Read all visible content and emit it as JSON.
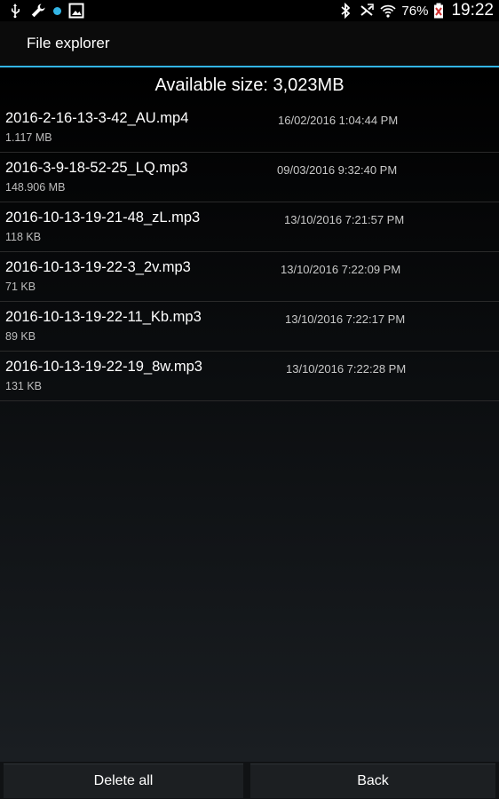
{
  "status_bar": {
    "battery_percent": "76%",
    "time": "19:22",
    "left_icons": [
      "usb-icon",
      "wrench-icon",
      "notification-dot-icon",
      "gallery-icon"
    ],
    "right_icons": [
      "bluetooth-icon",
      "mute-icon",
      "wifi-icon",
      "battery-icon"
    ],
    "accent_color": "#33b5e5"
  },
  "action_bar": {
    "title": "File explorer"
  },
  "available": {
    "text": "Available size: 3,023MB"
  },
  "files": [
    {
      "name": "2016-2-16-13-3-42_AU.mp4",
      "size": "1.117 MB",
      "date": "16/02/2016 1:04:44 PM"
    },
    {
      "name": "2016-3-9-18-52-25_LQ.mp3",
      "size": "148.906 MB",
      "date": "09/03/2016 9:32:40 PM"
    },
    {
      "name": "2016-10-13-19-21-48_zL.mp3",
      "size": "118 KB",
      "date": "13/10/2016 7:21:57 PM"
    },
    {
      "name": "2016-10-13-19-22-3_2v.mp3",
      "size": "71 KB",
      "date": "13/10/2016 7:22:09 PM"
    },
    {
      "name": "2016-10-13-19-22-11_Kb.mp3",
      "size": "89 KB",
      "date": "13/10/2016 7:22:17 PM"
    },
    {
      "name": "2016-10-13-19-22-19_8w.mp3",
      "size": "131 KB",
      "date": "13/10/2016 7:22:28 PM"
    }
  ],
  "buttons": {
    "delete_all": "Delete all",
    "back": "Back"
  }
}
